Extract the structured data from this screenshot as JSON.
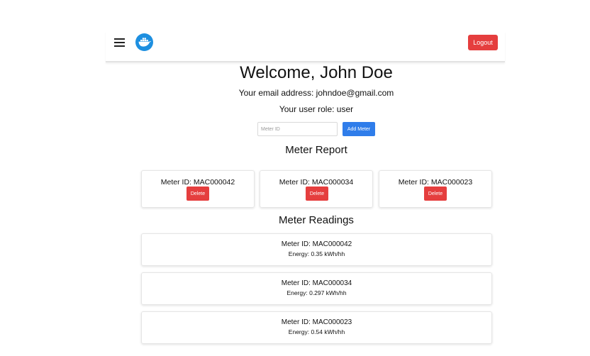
{
  "header": {
    "menu_icon": "hamburger-icon",
    "logo_icon": "docker-whale-icon",
    "logout_label": "Logout",
    "colors": {
      "logout": "#e53e3e",
      "logo": "#1d8fe0"
    }
  },
  "profile": {
    "welcome": "Welcome, John Doe",
    "email_line": "Your email address: johndoe@gmail.com",
    "role_line": "Your user role: user"
  },
  "add_meter": {
    "placeholder": "Meter ID",
    "value": "",
    "button_label": "Add Meter",
    "color": "#2f7dea"
  },
  "meter_report": {
    "title": "Meter Report",
    "delete_label": "Delete",
    "meters": [
      {
        "id_text": "Meter ID: MAC000042"
      },
      {
        "id_text": "Meter ID: MAC000034"
      },
      {
        "id_text": "Meter ID: MAC000023"
      }
    ]
  },
  "meter_readings": {
    "title": "Meter Readings",
    "readings": [
      {
        "id_text": "Meter ID: MAC000042",
        "energy_text": "Energy: 0.35 kWh/hh"
      },
      {
        "id_text": "Meter ID: MAC000034",
        "energy_text": "Energy: 0.297 kWh/hh"
      },
      {
        "id_text": "Meter ID: MAC000023",
        "energy_text": "Energy: 0.54 kWh/hh"
      }
    ]
  }
}
